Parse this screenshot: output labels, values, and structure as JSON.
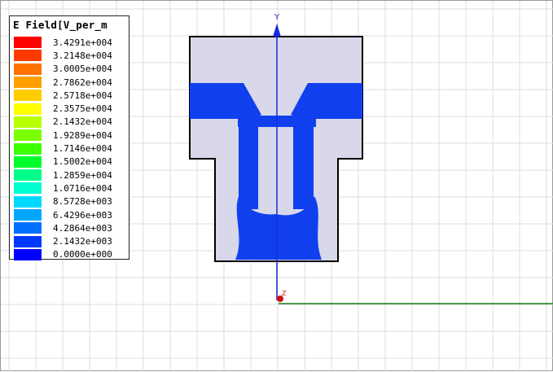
{
  "legend": {
    "title": "E Field[V_per_m",
    "entries": [
      {
        "value": "3.4291e+004",
        "color": "#ff0000"
      },
      {
        "value": "3.2148e+004",
        "color": "#ff3a00"
      },
      {
        "value": "3.0005e+004",
        "color": "#ff7200"
      },
      {
        "value": "2.7862e+004",
        "color": "#ffa000"
      },
      {
        "value": "2.5718e+004",
        "color": "#ffcc00"
      },
      {
        "value": "2.3575e+004",
        "color": "#ffff00"
      },
      {
        "value": "2.1432e+004",
        "color": "#b8ff00"
      },
      {
        "value": "1.9289e+004",
        "color": "#7cff00"
      },
      {
        "value": "1.7146e+004",
        "color": "#3cff00"
      },
      {
        "value": "1.5002e+004",
        "color": "#00ff2a"
      },
      {
        "value": "1.2859e+004",
        "color": "#00ff8a"
      },
      {
        "value": "1.0716e+004",
        "color": "#00ffd0"
      },
      {
        "value": "8.5728e+003",
        "color": "#00d8ff"
      },
      {
        "value": "6.4296e+003",
        "color": "#00a6ff"
      },
      {
        "value": "4.2864e+003",
        "color": "#0070ff"
      },
      {
        "value": "2.1432e+003",
        "color": "#0038ff"
      },
      {
        "value": "0.0000e+000",
        "color": "#0000ff"
      }
    ]
  },
  "axes": {
    "y_label": "Y",
    "z_label": "Z",
    "y_color": "#1a2bd8",
    "x_color": "#1a7a1a",
    "z_color": "#d01010"
  },
  "model": {
    "body_color": "#d8d8ea",
    "field_color": "#1040ee"
  }
}
